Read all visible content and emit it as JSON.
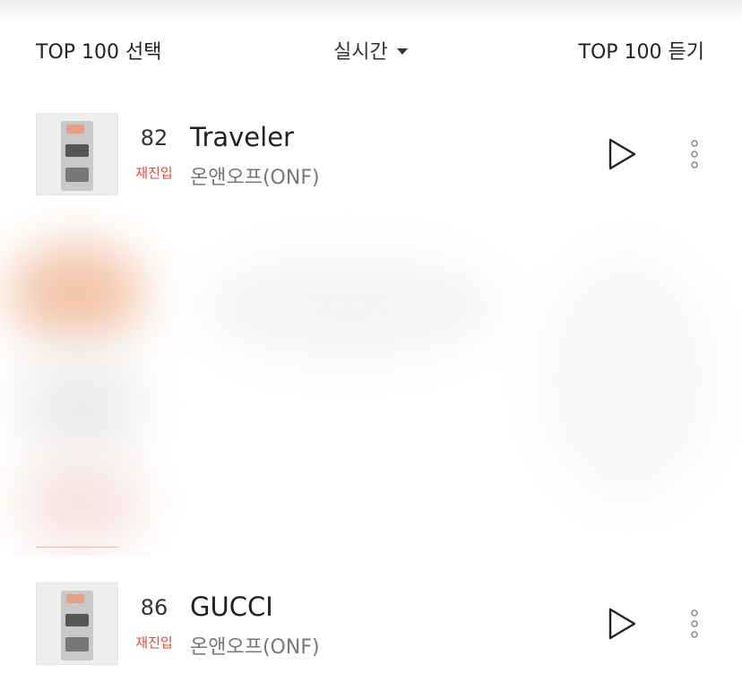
{
  "header": {
    "left_label": "TOP 100 선택",
    "center_label": "실시간",
    "right_label": "TOP 100 듣기"
  },
  "songs": [
    {
      "rank": "82",
      "badge": "재진입",
      "title": "Traveler",
      "artist": "온앤오프(ONF)"
    },
    {
      "rank": "86",
      "badge": "재진입",
      "title": "GUCCI",
      "artist": "온앤오프(ONF)"
    }
  ],
  "icons": {
    "play": "play-icon",
    "more": "more-vertical-icon",
    "dropdown": "caret-down-icon"
  },
  "colors": {
    "badge": "#e0493a",
    "text": "#222222",
    "artist": "#777777"
  }
}
